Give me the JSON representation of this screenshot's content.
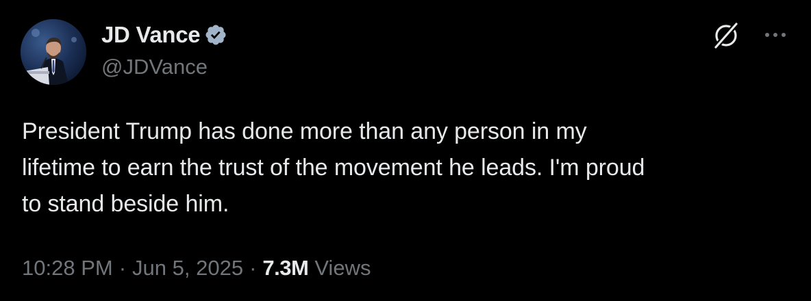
{
  "author": {
    "display_name": "JD Vance",
    "handle": "@JDVance",
    "verified": true,
    "verified_color": "#a1b4c8",
    "avatar_icon": "profile-photo-speaker-at-podium"
  },
  "actions": {
    "grok_icon": "slashed-circle-icon",
    "more_icon": "ellipsis-icon"
  },
  "tweet": {
    "text": "President Trump has done more than any person in my\nlifetime to earn the trust of the movement he leads. I'm proud\nto stand beside him."
  },
  "meta": {
    "time": "10:28 PM",
    "separator": "·",
    "date": "Jun 5, 2025",
    "views_count": "7.3M",
    "views_label": "Views"
  },
  "colors": {
    "background": "#000000",
    "primary_text": "#e7e9ea",
    "secondary_text": "#71767b"
  }
}
